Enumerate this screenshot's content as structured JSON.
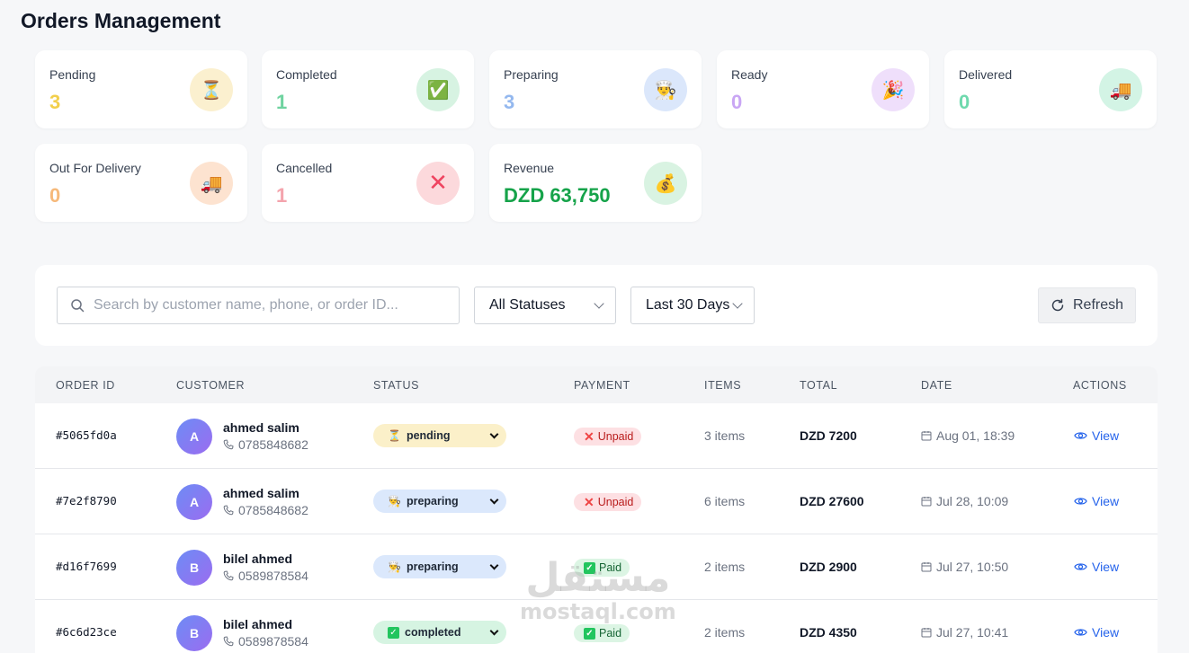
{
  "page": {
    "title": "Orders Management"
  },
  "stats": [
    {
      "label": "Pending",
      "value": "3",
      "icon": "hourglass-icon",
      "glyph": "⏳",
      "value_color": "#f2cf4b",
      "icon_bg": "#fbf0cf"
    },
    {
      "label": "Completed",
      "value": "1",
      "icon": "check-box-icon",
      "glyph": "✅",
      "value_color": "#6fd3a0",
      "icon_bg": "#d7f3e2"
    },
    {
      "label": "Preparing",
      "value": "3",
      "icon": "cook-icon",
      "glyph": "👨‍🍳",
      "value_color": "#94b8ef",
      "icon_bg": "#dbe7fb"
    },
    {
      "label": "Ready",
      "value": "0",
      "icon": "party-popper-icon",
      "glyph": "🎉",
      "value_color": "#c9a6f4",
      "icon_bg": "#efdffb"
    },
    {
      "label": "Delivered",
      "value": "0",
      "icon": "delivery-truck-icon",
      "glyph": "🚚",
      "value_color": "#6ed9ad",
      "icon_bg": "#d3f4e5"
    },
    {
      "label": "Out For Delivery",
      "value": "0",
      "icon": "delivery-truck-icon",
      "glyph": "🚚",
      "value_color": "#f6b97a",
      "icon_bg": "#fde3d0"
    },
    {
      "label": "Cancelled",
      "value": "1",
      "icon": "cross-mark-icon",
      "glyph": "✕",
      "value_color": "#f4a4ad",
      "icon_bg": "#fcd9dc"
    },
    {
      "label": "Revenue",
      "value": "DZD 63,750",
      "icon": "money-bag-icon",
      "glyph": "💰",
      "value_color": "#16a34a",
      "icon_bg": "#d9f3e2"
    }
  ],
  "filters": {
    "search_placeholder": "Search by customer name, phone, or order ID...",
    "status_select": "All Statuses",
    "date_select": "Last 30 Days",
    "refresh_label": "Refresh"
  },
  "table": {
    "headers": {
      "order_id": "ORDER ID",
      "customer": "CUSTOMER",
      "status": "STATUS",
      "payment": "PAYMENT",
      "items": "ITEMS",
      "total": "TOTAL",
      "date": "DATE",
      "actions": "ACTIONS"
    },
    "rows": [
      {
        "order_id": "#5065fd0a",
        "initial": "A",
        "name": "ahmed salim",
        "phone": "0785848682",
        "status": "pending",
        "status_glyph": "⏳",
        "status_bg": "#fbf0c9",
        "payment": "Unpaid",
        "payment_glyph": "✕",
        "items": "3 items",
        "total": "DZD 7200",
        "date": "Aug 01, 18:39",
        "action": "View"
      },
      {
        "order_id": "#7e2f8790",
        "initial": "A",
        "name": "ahmed salim",
        "phone": "0785848682",
        "status": "preparing",
        "status_glyph": "👨‍🍳",
        "status_bg": "#dbe8fc",
        "payment": "Unpaid",
        "payment_glyph": "✕",
        "items": "6 items",
        "total": "DZD 27600",
        "date": "Jul 28, 10:09",
        "action": "View"
      },
      {
        "order_id": "#d16f7699",
        "initial": "B",
        "name": "bilel ahmed",
        "phone": "0589878584",
        "status": "preparing",
        "status_glyph": "👨‍🍳",
        "status_bg": "#dbe8fc",
        "payment": "Paid",
        "payment_glyph": "✓",
        "items": "2 items",
        "total": "DZD 2900",
        "date": "Jul 27, 10:50",
        "action": "View"
      },
      {
        "order_id": "#6c6d23ce",
        "initial": "B",
        "name": "bilel ahmed",
        "phone": "0589878584",
        "status": "completed",
        "status_glyph": "✓",
        "status_bg": "#d6f4e2",
        "payment": "Paid",
        "payment_glyph": "✓",
        "items": "2 items",
        "total": "DZD 4350",
        "date": "Jul 27, 10:41",
        "action": "View"
      }
    ]
  },
  "watermark": {
    "line1": "مستقل",
    "line2": "mostaql.com"
  }
}
